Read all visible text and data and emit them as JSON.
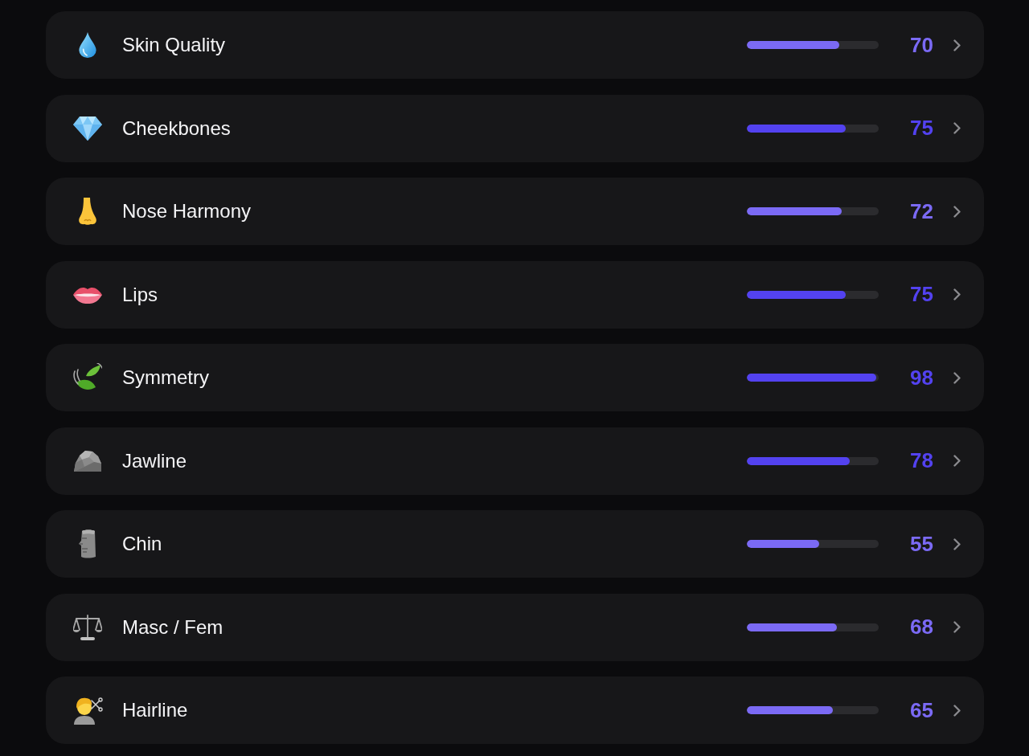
{
  "items": [
    {
      "label": "Skin Quality",
      "score": "70",
      "level": 0.7,
      "color": "#7b6af5"
    },
    {
      "label": "Cheekbones",
      "score": "75",
      "level": 0.75,
      "color": "#5342f0"
    },
    {
      "label": "Nose Harmony",
      "score": "72",
      "level": 0.72,
      "color": "#7b6af5"
    },
    {
      "label": "Lips",
      "score": "75",
      "level": 0.75,
      "color": "#5342f0"
    },
    {
      "label": "Symmetry",
      "score": "98",
      "level": 0.98,
      "color": "#5342f0"
    },
    {
      "label": "Jawline",
      "score": "78",
      "level": 0.78,
      "color": "#5342f0"
    },
    {
      "label": "Chin",
      "score": "55",
      "level": 0.55,
      "color": "#7b6af5"
    },
    {
      "label": "Masc / Fem",
      "score": "68",
      "level": 0.68,
      "color": "#7b6af5"
    },
    {
      "label": "Hairline",
      "score": "65",
      "level": 0.65,
      "color": "#7b6af5"
    }
  ]
}
